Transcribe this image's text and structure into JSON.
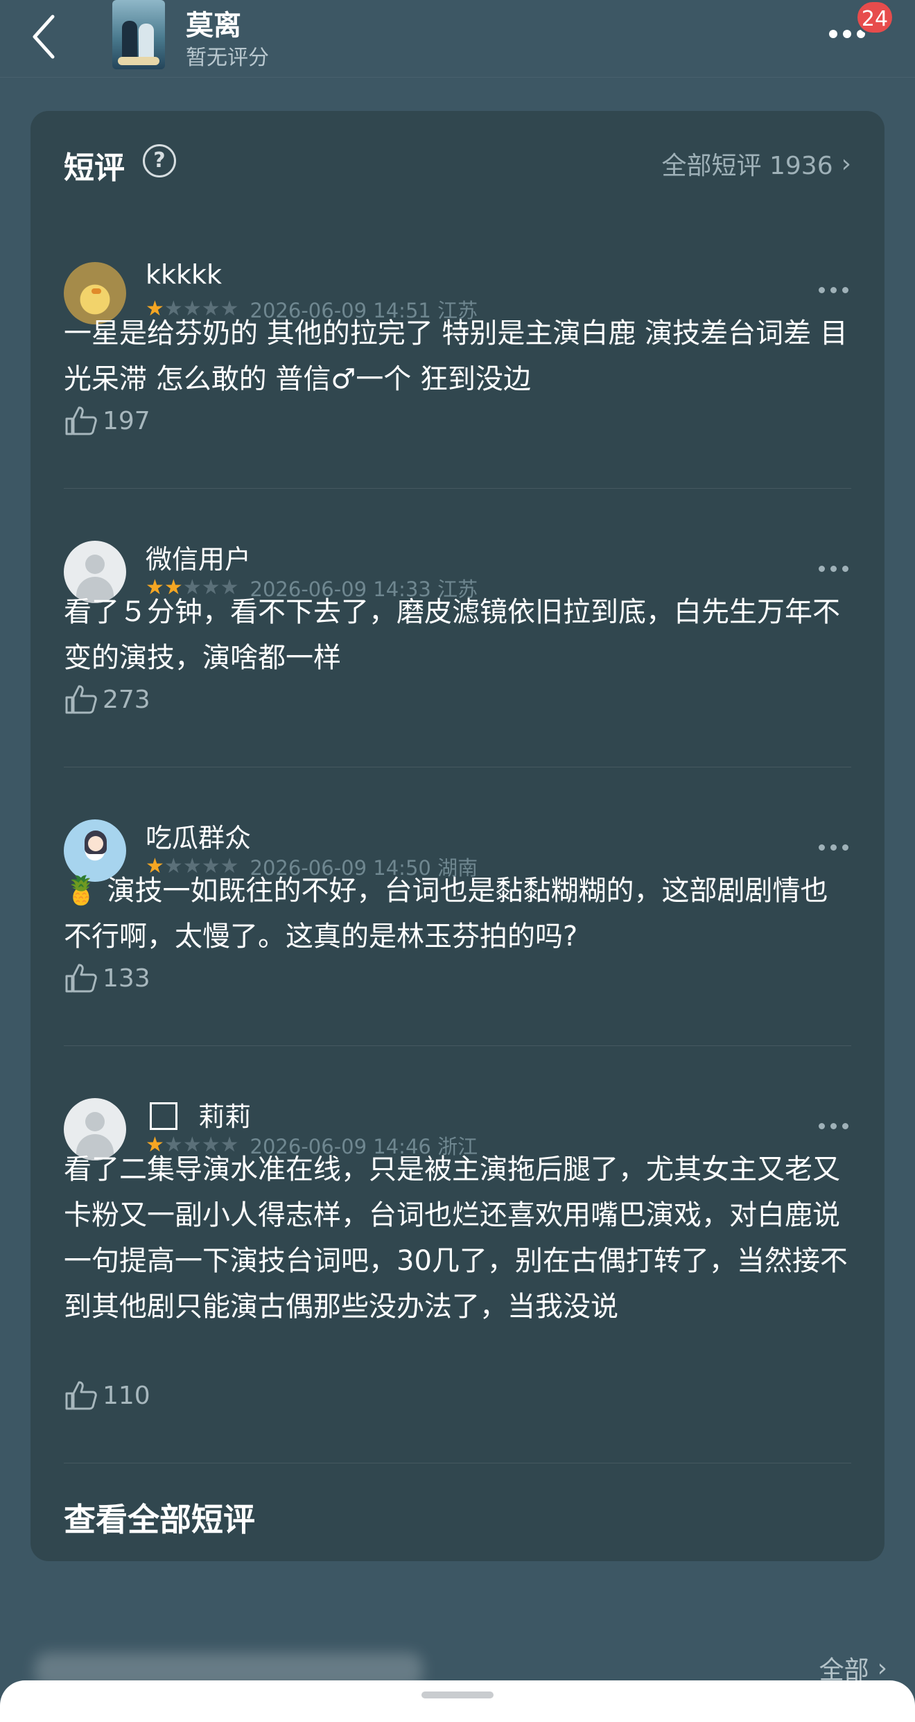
{
  "header": {
    "show_title": "莫离",
    "rating_text": "暂无评分",
    "notification_count": "24"
  },
  "short_reviews": {
    "title": "短评",
    "help_symbol": "?",
    "all_link": "全部短评 1936",
    "comments": [
      {
        "user": "kkkkk",
        "rating": 1,
        "meta": "2026-06-09 14:51 江苏",
        "text": "一星是给芬奶的 其他的拉完了 特别是主演白鹿 演技差台词差 目光呆滞 怎么敢的 普信♂一个 狂到没边",
        "likes": "197",
        "avatar": "duckling-avatar"
      },
      {
        "user": "微信用户",
        "rating": 2,
        "meta": "2026-06-09 14:33 江苏",
        "text": "看了５分钟，看不下去了，磨皮滤镜依旧拉到底，白先生万年不变的演技，演啥都一样",
        "likes": "273",
        "avatar": "default-avatar"
      },
      {
        "user": "吃瓜群众",
        "rating": 1,
        "meta": "2026-06-09 14:50 湖南",
        "text": "🍍 演技一如既往的不好，台词也是黏黏糊糊的，这部剧剧情也不行啊，太慢了。这真的是林玉芬拍的吗?",
        "likes": "133",
        "avatar": "anime-girl-avatar"
      },
      {
        "user": "莉莉",
        "rating": 1,
        "meta": "2026-06-09 14:46 浙江",
        "text": "看了二集导演水准在线，只是被主演拖后腿了，尤其女主又老又卡粉又一副小人得志样，台词也烂还喜欢用嘴巴演戏，对白鹿说一句提高一下演技台词吧，30几了，别在古偶打转了，当然接不到其他剧只能演古偶那些没办法了，当我没说",
        "likes": "110",
        "avatar": "default-avatar"
      }
    ],
    "view_all_label": "查看全部短评"
  },
  "bottom": {
    "all_label": "全部"
  },
  "colors": {
    "background": "#3d5764",
    "card": "#31474f",
    "star_on": "#f5a623",
    "star_off": "#5b7079",
    "badge": "#e74c4c"
  }
}
